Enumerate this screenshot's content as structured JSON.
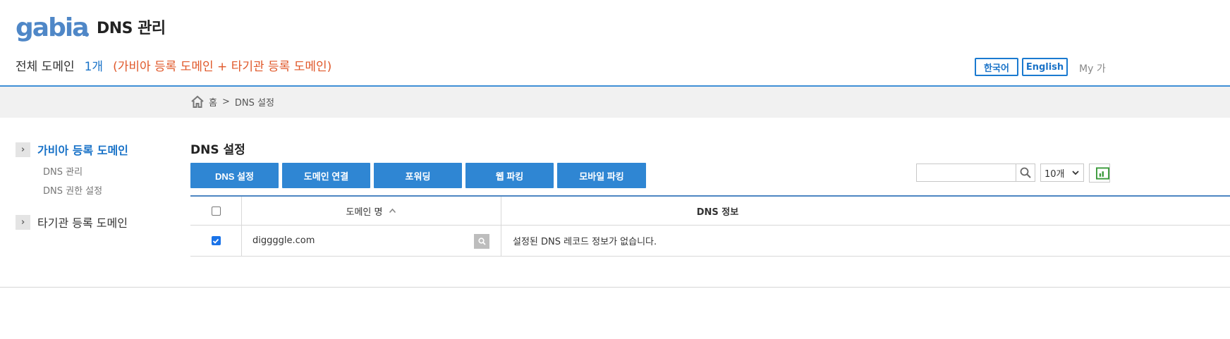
{
  "header": {
    "logo_text": "gabia.",
    "title": "DNS 관리",
    "summary_label": "전체 도메인",
    "summary_count": "1개",
    "summary_note": "(가비아 등록 도메인 + 타기관 등록 도메인)",
    "lang_korean": "한국어",
    "lang_english": "English",
    "my_link": "My 가"
  },
  "breadcrumb": {
    "home": "홈",
    "separator": ">",
    "current": "DNS 설정"
  },
  "sidebar": {
    "groups": [
      {
        "label": "가비아 등록 도메인",
        "items": [
          "DNS 관리",
          "DNS 권한 설정"
        ]
      },
      {
        "label": "타기관 등록 도메인"
      }
    ]
  },
  "main": {
    "section_title": "DNS 설정",
    "tabs": [
      "DNS 설정",
      "도메인 연결",
      "포워딩",
      "웹 파킹",
      "모바일 파킹"
    ],
    "search": {
      "placeholder": "",
      "value": ""
    },
    "page_size": "10개"
  },
  "table": {
    "columns": [
      "도메인 명",
      "DNS 정보"
    ],
    "rows": [
      {
        "checked": true,
        "domain": "diggggle.com",
        "dns_info": "설정된 DNS 레코드 정보가 없습니다."
      }
    ]
  },
  "colors": {
    "brand_blue": "#2f86d3",
    "link_blue": "#1a73c8",
    "note_orange": "#e0582a",
    "table_top_border": "#4d86c2"
  },
  "icons": [
    "home-icon",
    "chevron-right-icon",
    "search-icon",
    "chevron-down-icon",
    "sort-up-icon",
    "excel-icon",
    "magnifier-icon",
    "check-icon"
  ]
}
